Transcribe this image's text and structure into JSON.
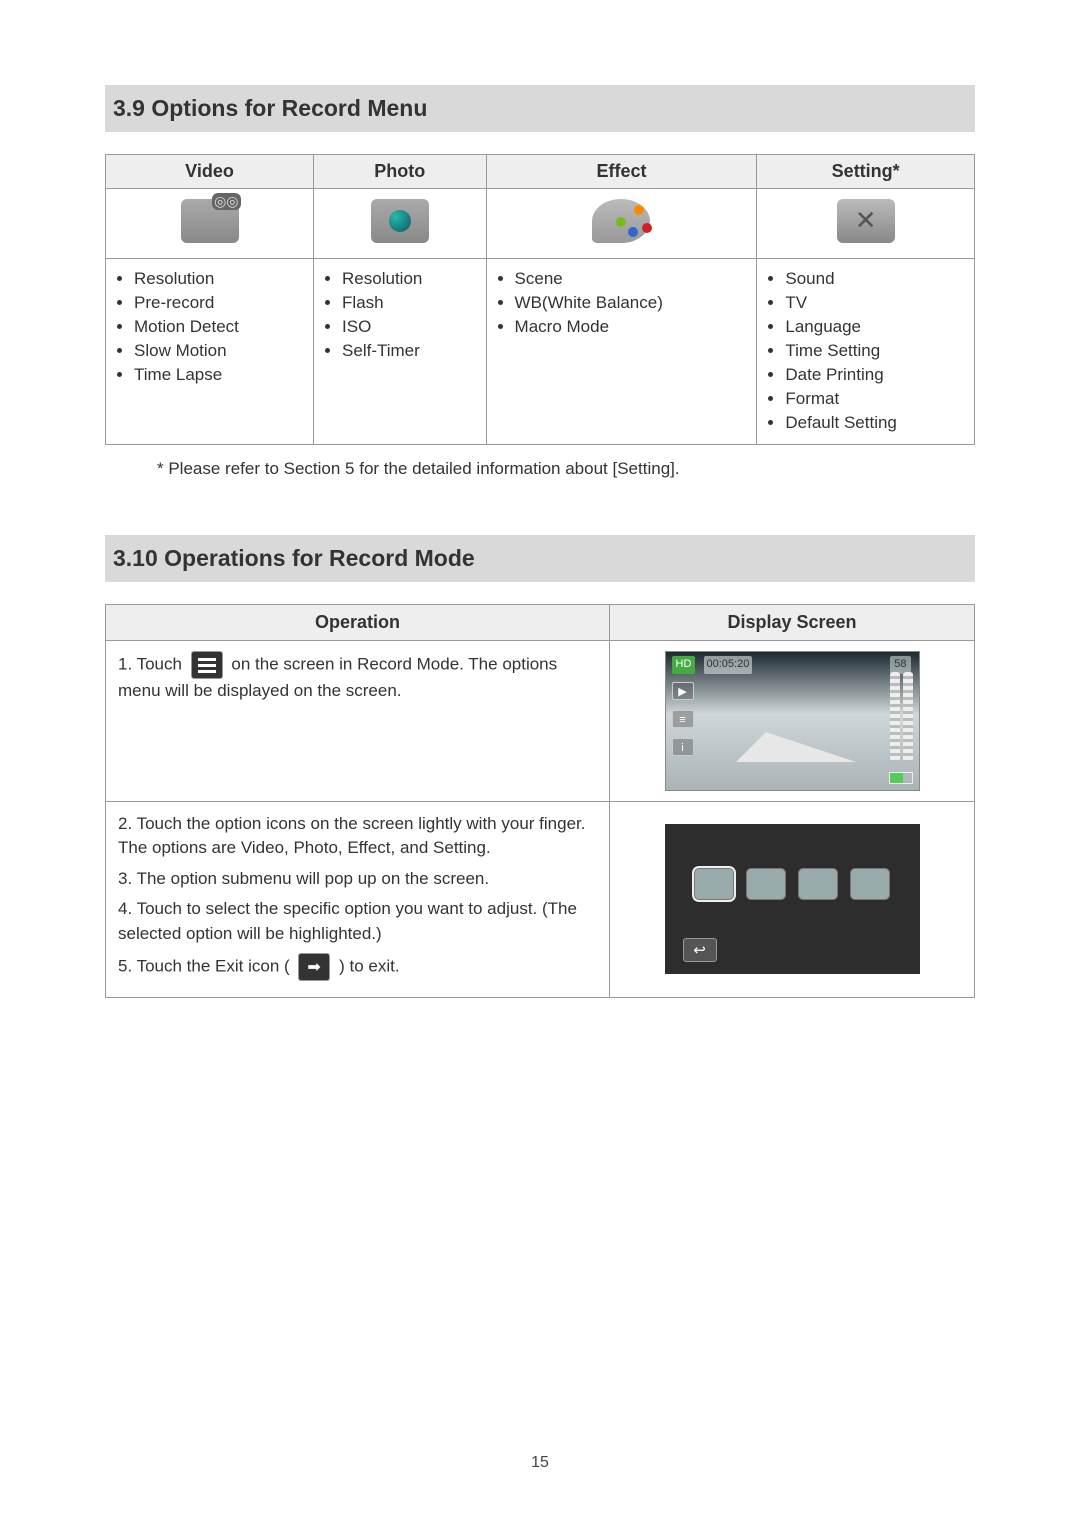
{
  "page_number": "15",
  "sections": {
    "s1": {
      "heading": "3.9 Options for Record Menu",
      "columns": [
        "Video",
        "Photo",
        "Effect",
        "Setting*"
      ],
      "options": {
        "video": [
          "Resolution",
          "Pre-record",
          "Motion Detect",
          "Slow Motion",
          "Time Lapse"
        ],
        "photo": [
          "Resolution",
          "Flash",
          "ISO",
          "Self-Timer"
        ],
        "effect": [
          "Scene",
          "WB(White Balance)",
          "Macro Mode"
        ],
        "setting": [
          "Sound",
          "TV",
          "Language",
          "Time Setting",
          "Date Printing",
          "Format",
          "Default Setting"
        ]
      },
      "footnote": "* Please refer to Section 5 for the detailed information about [Setting]."
    },
    "s2": {
      "heading": "3.10 Operations for Record Mode",
      "columns": [
        "Operation",
        "Display Screen"
      ],
      "steps": {
        "step1_a": "1. Touch ",
        "step1_b": " on the screen in Record Mode. The options menu will be displayed on the screen.",
        "step2": "2. Touch the option icons on the screen lightly with your finger. The options are Video, Photo, Effect, and Setting.",
        "step3": "3. The option submenu will pop up on the screen.",
        "step4": "4. Touch to select the specific option you want to adjust. (The selected option will be highlighted.)",
        "step5_a": "5. Touch the Exit icon ( ",
        "step5_b": " ) to exit."
      },
      "display1": {
        "hd": "HD",
        "time": "00:05:20",
        "count": "58"
      }
    }
  }
}
